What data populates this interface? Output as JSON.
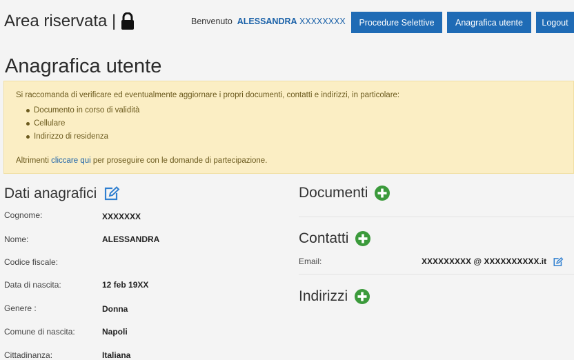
{
  "header": {
    "brand": "Area riservata |",
    "welcome_prefix": "Benvenuto",
    "user_name": "ALESSANDRA",
    "user_surname": "XXXXXXXX",
    "nav": {
      "procedure": "Procedure Selettive",
      "anagrafica": "Anagrafica utente",
      "logout": "Logout"
    }
  },
  "page_title": "Anagrafica utente",
  "notice": {
    "intro": "Si raccomanda di verificare ed eventualmente aggiornare i propri documenti, contatti e indirizzi, in particolare:",
    "items": [
      "Documento in corso di validità",
      "Cellulare",
      "Indirizzo di residenza"
    ],
    "outro_prefix": "Altrimenti",
    "outro_link": "cliccare qui",
    "outro_suffix": "per proseguire con le domande di partecipazione."
  },
  "dati": {
    "title": "Dati anagrafici",
    "fields": [
      {
        "label": "Cognome:",
        "value": "XXXXXXX"
      },
      {
        "label": "Nome:",
        "value": "ALESSANDRA"
      },
      {
        "label": "Codice fiscale:",
        "value": ""
      },
      {
        "label": "Data di nascita:",
        "value": "12 feb 19XX"
      },
      {
        "label": "Genere :",
        "value": "Donna"
      },
      {
        "label": "Comune di nascita:",
        "value": "Napoli"
      },
      {
        "label": "Cittadinanza:",
        "value": "Italiana"
      }
    ]
  },
  "documenti": {
    "title": "Documenti"
  },
  "contatti": {
    "title": "Contatti",
    "email_label": "Email:",
    "email_value": "XXXXXXXXX @ XXXXXXXXXX.it"
  },
  "indirizzi": {
    "title": "Indirizzi"
  },
  "colors": {
    "primary": "#1f6bb5",
    "accent_green": "#3b9a3b",
    "notice_bg": "#fbeec4",
    "link": "#1a61a8"
  },
  "icons": {
    "lock": "lock-icon",
    "edit": "edit-icon",
    "add": "plus-circle-icon"
  }
}
